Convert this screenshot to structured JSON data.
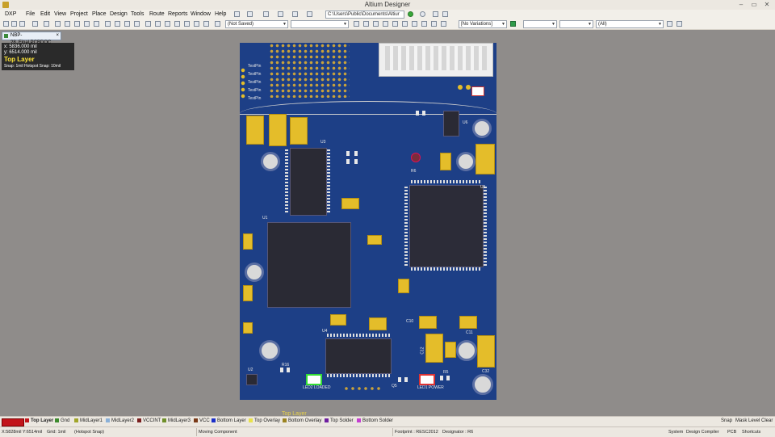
{
  "window": {
    "title": "Altium Designer",
    "minimize": "–",
    "maximize": "▭",
    "close": "✕"
  },
  "menu": [
    "DXP",
    "File",
    "Edit",
    "View",
    "Project",
    "Place",
    "Design",
    "Tools",
    "Route",
    "Reports",
    "Window",
    "Help"
  ],
  "toolbar": {
    "path_combo": "C:\\Users\\Public\\Documents\\Altiur",
    "save_state_combo": "(Not Saved)",
    "variations_combo": "[No Variations]",
    "filter_combo": "(All)"
  },
  "document_tab": {
    "label": "NBP-28_Final.PCBDOC"
  },
  "hud": {
    "x": "x:  5836.000  mil",
    "y": "y:  6514.000  mil",
    "layer": "Top Layer",
    "snap": "Snap: 1mil Hotspot Snap: 10mil"
  },
  "board": {
    "labels": {
      "u1": "U1",
      "u2": "U2",
      "u3": "U3",
      "u4": "U4",
      "u5": "U5",
      "u6": "U6",
      "c10": "C10",
      "c11": "C11",
      "c12": "C12",
      "c32": "C32",
      "r5": "R5",
      "r6": "R6",
      "r16": "R16",
      "q5": "Q5",
      "led1": "LED1 POWER",
      "led2": "LED2 LOADED",
      "tp_label": "TestPin",
      "top_layer_mark": "Top Layer"
    }
  },
  "layer_tabs": [
    {
      "label": "Top Layer",
      "color": "#c2151b",
      "active": true
    },
    {
      "label": "Gnd",
      "color": "#3d8b2e"
    },
    {
      "label": "MidLayer1",
      "color": "#a1a52a"
    },
    {
      "label": "MidLayer2",
      "color": "#8ab0d8"
    },
    {
      "label": "VCCINT",
      "color": "#7a1f1f"
    },
    {
      "label": "MidLayer3",
      "color": "#6f8f2a"
    },
    {
      "label": "VCC",
      "color": "#7a3a18"
    },
    {
      "label": "Bottom Layer",
      "color": "#1b2ec8"
    },
    {
      "label": "Top Overlay",
      "color": "#e9e24a"
    },
    {
      "label": "Bottom Overlay",
      "color": "#9b8320"
    },
    {
      "label": "Top Solder",
      "color": "#6e1fa0"
    },
    {
      "label": "Bottom Solder",
      "color": "#c43fd1"
    }
  ],
  "layer_tab_right": {
    "snap": "Snap",
    "mask": "Mask Level",
    "clear": "Clear"
  },
  "status": {
    "coords": "X:5828mil Y:6514mil",
    "grid": "Grid: 1mil",
    "hotspot": "(Hotspot Snap)",
    "action": "Moving Component",
    "footprint": "Footprint : RESC2012",
    "designator": "Designator : R6",
    "panels": [
      "System",
      "Design Compiler",
      "PCB",
      "Shortcuts"
    ]
  }
}
